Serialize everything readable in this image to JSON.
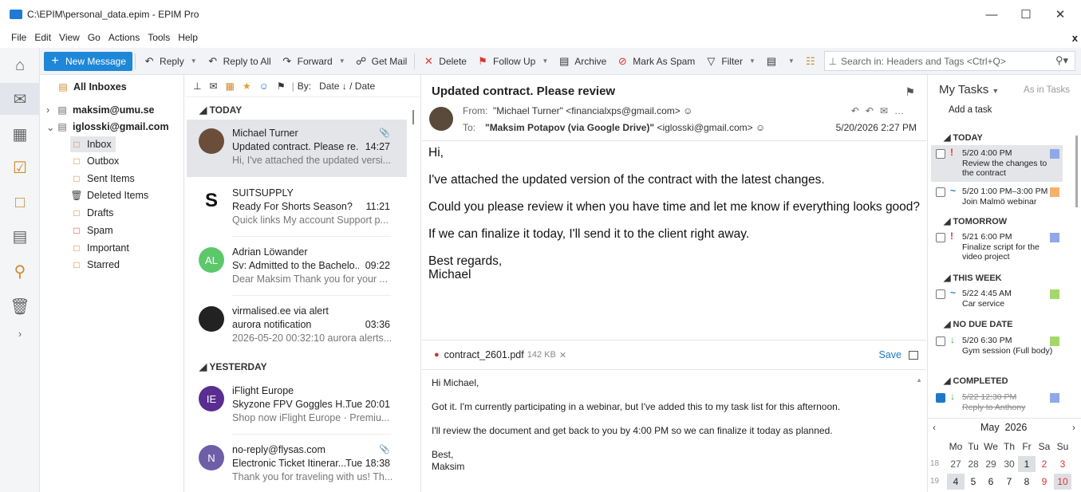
{
  "window": {
    "title": "C:\\EPIM\\personal_data.epim - EPIM Pro"
  },
  "menu": [
    "File",
    "Edit",
    "View",
    "Go",
    "Actions",
    "Tools",
    "Help"
  ],
  "toolbar": {
    "new_message": "New Message",
    "reply": "Reply",
    "reply_all": "Reply to All",
    "forward": "Forward",
    "get_mail": "Get Mail",
    "delete": "Delete",
    "follow_up": "Follow Up",
    "archive": "Archive",
    "mark_spam": "Mark As Spam",
    "filter": "Filter",
    "search_placeholder": "Search in: Headers and Tags <Ctrl+Q>"
  },
  "folders": {
    "all_inboxes": "All Inboxes",
    "accounts": [
      "maksim@umu.se",
      "iglosski@gmail.com"
    ],
    "items": [
      "Inbox",
      "Outbox",
      "Sent Items",
      "Deleted Items",
      "Drafts",
      "Spam",
      "Important",
      "Starred"
    ]
  },
  "list": {
    "sort_by": "By:",
    "sort_value": "Date ↓ / Date",
    "groups": [
      "TODAY",
      "YESTERDAY"
    ],
    "messages": [
      {
        "sender": "Michael Turner",
        "subject": "Updated contract. Please re...",
        "time": "14:27",
        "preview": "Hi, I've attached the updated versi...",
        "avatar_text": "",
        "avatar_color": "#6b4e3a"
      },
      {
        "sender": "SUITSUPPLY",
        "subject": "Ready For Shorts Season?",
        "time": "11:21",
        "preview": "Quick links My account Support p...",
        "avatar_text": "S",
        "avatar_color": "#ffffff"
      },
      {
        "sender": "Adrian Löwander",
        "subject": "Sv: Admitted to the Bachelo...",
        "time": "09:22",
        "preview": "Dear Maksim Thank you for your ...",
        "avatar_text": "AL",
        "avatar_color": "#5cc86a"
      },
      {
        "sender": "virmalised.ee via alert",
        "subject": "aurora notification",
        "time": "03:36",
        "preview": "2026-05-20 00:32:10 aurora alerts...",
        "avatar_text": "",
        "avatar_color": "#222222"
      },
      {
        "sender": "iFlight Europe",
        "subject": "Skyzone FPV Goggles H...",
        "time": "Tue 20:01",
        "preview": "Shop now iFlight Europe · Premiu...",
        "avatar_text": "IE",
        "avatar_color": "#5a2d91"
      },
      {
        "sender": "no-reply@flysas.com",
        "subject": "Electronic Ticket Itinerar...",
        "time": "Tue 18:38",
        "preview": "Thank you for traveling with us! Th...",
        "avatar_text": "N",
        "avatar_color": "#6e5ea8"
      }
    ]
  },
  "reader": {
    "subject": "Updated contract. Please review",
    "from_label": "From:",
    "from": "\"Michael Turner\" <financialxps@gmail.com>",
    "to_label": "To:",
    "to_name": "\"Maksim Potapov (via Google Drive)\"",
    "to_addr": " <iglosski@gmail.com>",
    "date": "5/20/2026 2:27 PM",
    "body": [
      "Hi,",
      "I've attached the updated version of the contract with the latest changes.",
      "Could you please review it when you have time and let me know if everything looks good?",
      "If we can finalize it today, I'll send it to the client right away.",
      "Best regards,",
      "Michael"
    ],
    "attachment": {
      "name": "contract_2601.pdf",
      "size": "142 KB",
      "save": "Save"
    },
    "reply": [
      "Hi Michael,",
      "Got it. I'm currently participating in a webinar, but I've added this to my task list for this afternoon.",
      "I'll review the document and get back to you by 4:00 PM so we can finalize it today as planned.",
      "Best,",
      "Maksim"
    ]
  },
  "tasks": {
    "title": "My Tasks",
    "view": "As in Tasks",
    "add": "Add a task",
    "groups": [
      "TODAY",
      "TOMORROW",
      "THIS WEEK",
      "NO DUE DATE",
      "COMPLETED"
    ],
    "items": [
      {
        "when": "5/20 4:00 PM",
        "text": "Review the changes to the contract",
        "priority": "!",
        "color": "#8fa8e8"
      },
      {
        "when": "5/20 1:00 PM–3:00 PM",
        "text": "Join Malmö webinar",
        "priority": "~",
        "color": "#f5b06a"
      },
      {
        "when": "5/21 6:00 PM",
        "text": "Finalize script for the video project",
        "priority": "!",
        "color": "#8fa8e8"
      },
      {
        "when": "5/22 4:45 AM",
        "text": "Car service",
        "priority": "~",
        "color": "#a3d86a"
      },
      {
        "when": "5/20 6:30 PM",
        "text": "Gym session (Full body)",
        "priority": "↓",
        "color": "#a3d86a"
      },
      {
        "when": "5/22 12:30 PM",
        "text": "Reply to Anthony",
        "priority": "↓",
        "color": "#8fa8e8"
      }
    ]
  },
  "calendar": {
    "month": "May",
    "year": "2026",
    "weekdays": [
      "Mo",
      "Tu",
      "We",
      "Th",
      "Fr",
      "Sa",
      "Su"
    ],
    "weeks": [
      {
        "num": "18",
        "days": [
          "27",
          "28",
          "29",
          "30",
          "1",
          "2",
          "3"
        ]
      },
      {
        "num": "19",
        "days": [
          "4",
          "5",
          "6",
          "7",
          "8",
          "9",
          "10"
        ]
      }
    ]
  }
}
